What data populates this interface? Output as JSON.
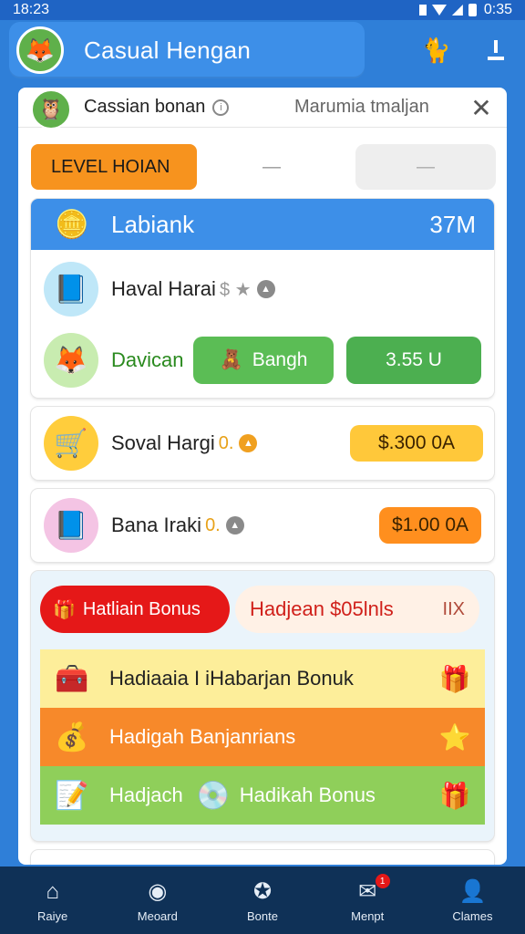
{
  "status_bar": {
    "time": "18:23",
    "right_time": "0:35"
  },
  "app_bar": {
    "title": "Casual Hengan"
  },
  "sheet": {
    "header_title": "Cassian bonan",
    "header_subtitle": "Marumia tmaljan",
    "level_label": "LEVEL HOIAN",
    "level_dash": "—",
    "level_box": "—"
  },
  "main_card": {
    "title": "Labiank",
    "value": "37M",
    "row1_label": "Haval Harai",
    "row1_sub": "$ ★",
    "row2_label": "Davican",
    "row2_button": "Bangh",
    "row2_value_button": "3.55 U"
  },
  "items": [
    {
      "label": "Soval Hargi",
      "sub": "0.",
      "button": "$.300 0A"
    },
    {
      "label": "Bana Iraki",
      "sub": "0.",
      "button": "$1.00 0A"
    }
  ],
  "bonus_panel": {
    "tab_active": "Hatliain Bonus",
    "tab_other": "Hadjean $05lnls",
    "tab_x": "IIX",
    "rows": [
      {
        "label": "Hadiaaia I iHabarjan Bonuk",
        "bg": "#fdee9a",
        "color": "#222222"
      },
      {
        "label": "Hadigah Banjanrians",
        "bg": "#f7892a",
        "color": "#ffffff"
      },
      {
        "label": "Hadjach",
        "label2": "Hadikah Bonus",
        "bg": "#8fcf5a",
        "color": "#ffffff"
      }
    ]
  },
  "bottom_nav": [
    {
      "label": "Raiye",
      "icon": "home-icon"
    },
    {
      "label": "Meoard",
      "icon": "record-icon"
    },
    {
      "label": "Bonte",
      "icon": "badge-icon"
    },
    {
      "label": "Menpt",
      "icon": "message-icon",
      "badge": "1"
    },
    {
      "label": "Clames",
      "icon": "profile-icon"
    }
  ],
  "colors": {
    "primary": "#3d8fe8",
    "danger": "#e51818",
    "accent": "#f7931e",
    "success": "#4caf50",
    "nav_bg": "#0f3157"
  }
}
